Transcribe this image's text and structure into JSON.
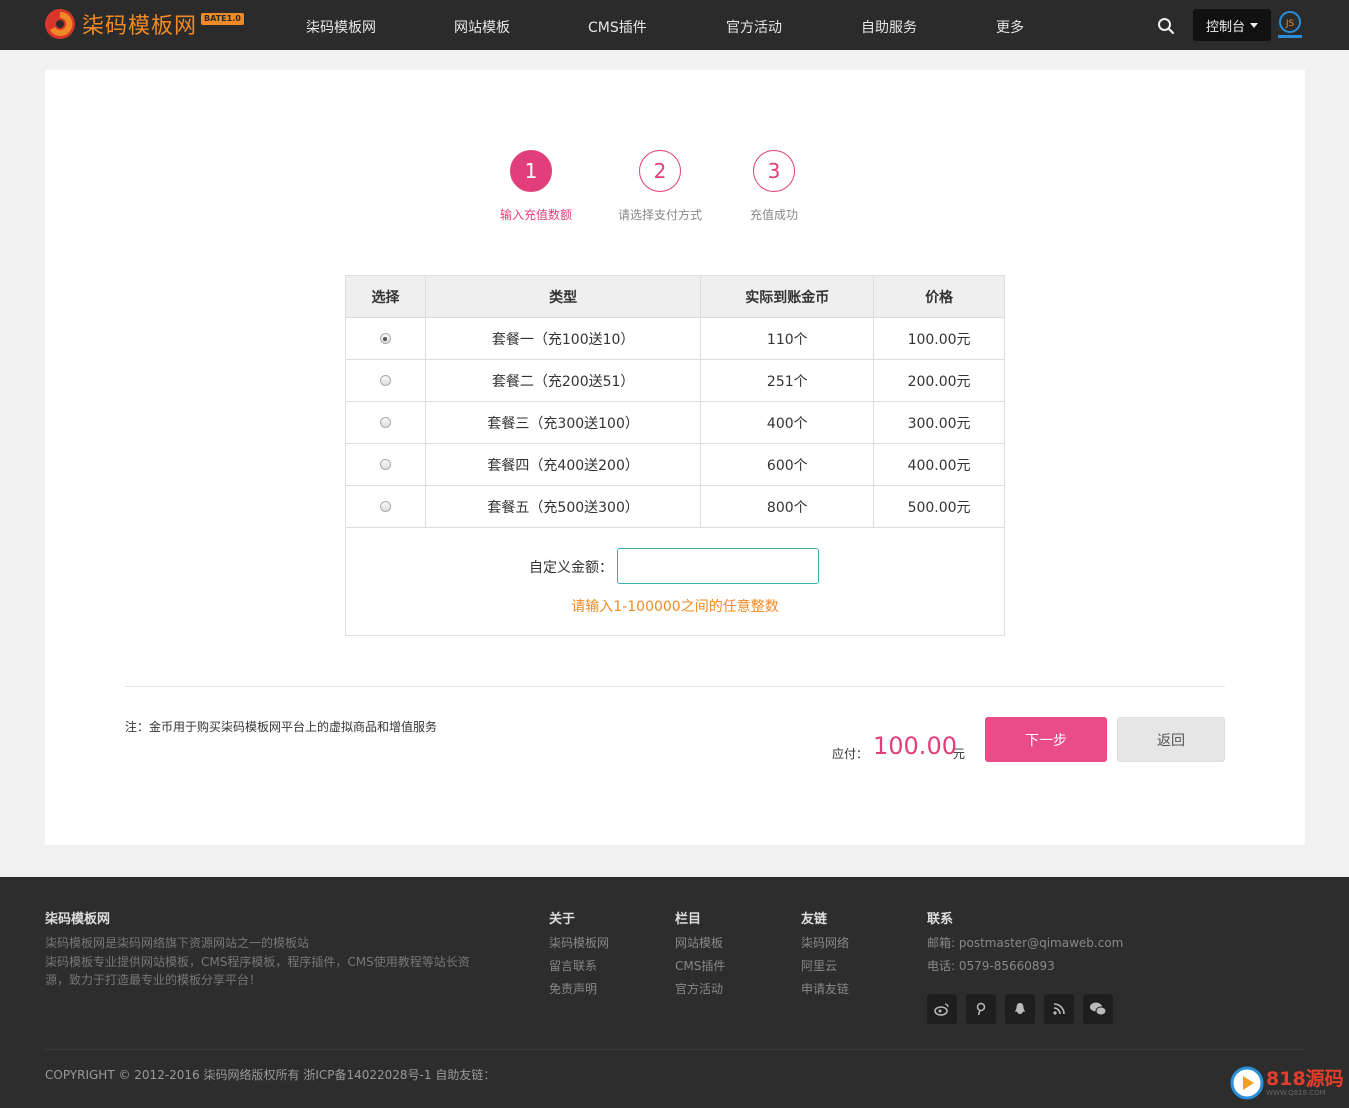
{
  "header": {
    "logo_text": "柒码模板网",
    "logo_badge": "BATE1.0",
    "nav": [
      "柒码模板网",
      "网站模板",
      "CMS插件",
      "官方活动",
      "自助服务",
      "更多"
    ],
    "console_label": "控制台"
  },
  "steps": [
    {
      "number": "1",
      "label": "输入充值数额",
      "active": true
    },
    {
      "number": "2",
      "label": "请选择支付方式",
      "active": false
    },
    {
      "number": "3",
      "label": "充值成功",
      "active": false
    }
  ],
  "plans": {
    "headers": [
      "选择",
      "类型",
      "实际到账金币",
      "价格"
    ],
    "rows": [
      {
        "type": "套餐一（充100送10）",
        "coins": "110个",
        "price": "100.00元",
        "selected": true
      },
      {
        "type": "套餐二（充200送51）",
        "coins": "251个",
        "price": "200.00元",
        "selected": false
      },
      {
        "type": "套餐三（充300送100）",
        "coins": "400个",
        "price": "300.00元",
        "selected": false
      },
      {
        "type": "套餐四（充400送200）",
        "coins": "600个",
        "price": "400.00元",
        "selected": false
      },
      {
        "type": "套餐五（充500送300）",
        "coins": "800个",
        "price": "500.00元",
        "selected": false
      }
    ]
  },
  "custom": {
    "label": "自定义金额：",
    "value": "",
    "hint": "请输入1-100000之间的任意整数"
  },
  "summary": {
    "note": "注：金币用于购买柒码模板网平台上的虚拟商品和增值服务",
    "pay_label": "应付：",
    "amount": "100.00",
    "unit": "元",
    "next_label": "下一步",
    "back_label": "返回"
  },
  "footer": {
    "brand_title": "柒码模板网",
    "brand_desc_1": "柒码模板网是柒码网络旗下资源网站之一的模板站",
    "brand_desc_2": "柒码模板专业提供网站模板，CMS程序模板，程序插件，CMS使用教程等站长资",
    "brand_desc_3": "源，致力于打造最专业的模板分享平台！",
    "columns": [
      {
        "title": "关于",
        "links": [
          "柒码模板网",
          "留言联系",
          "免责声明"
        ]
      },
      {
        "title": "栏目",
        "links": [
          "网站模板",
          "CMS插件",
          "官方活动"
        ]
      },
      {
        "title": "友链",
        "links": [
          "柒码网络",
          "阿里云",
          "申请友链"
        ]
      }
    ],
    "contact_title": "联系",
    "email": "邮箱: postmaster@qimaweb.com",
    "phone": "电话: 0579-85660893",
    "social_icons": [
      "weibo-icon",
      "pinterest-icon",
      "qq-icon",
      "rss-icon",
      "wechat-icon"
    ],
    "copyright": "COPYRIGHT © 2012-2016 柒码网络版权所有 浙ICP备14022028号-1 自助友链："
  },
  "watermark": {
    "text": "818源码",
    "sub": "WWW.Q818.COM"
  },
  "colors": {
    "accent": "#e23e7b",
    "orange": "#f08a24",
    "header_bg": "#2b2b2b",
    "footer_bg": "#2d2d2d"
  }
}
